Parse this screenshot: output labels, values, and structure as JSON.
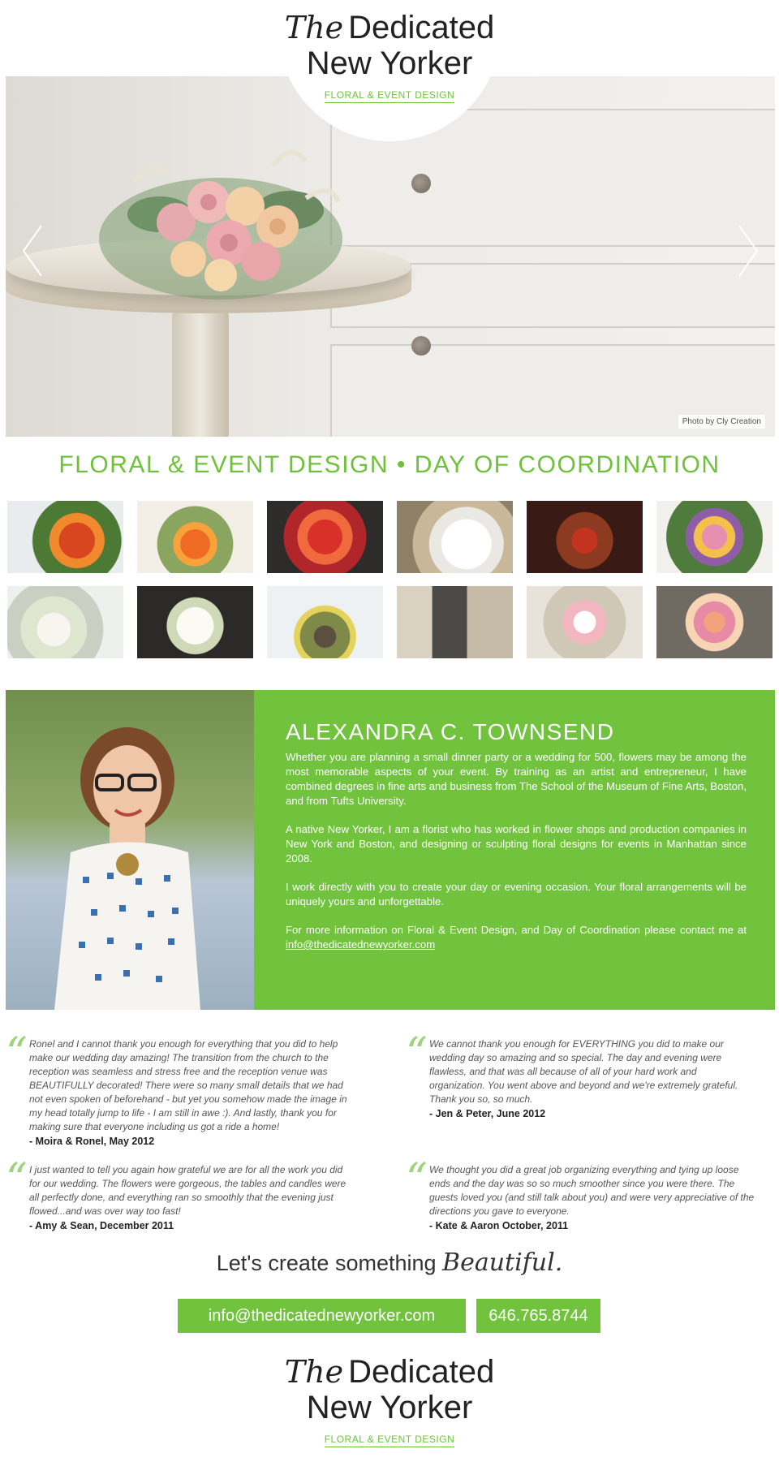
{
  "logo": {
    "the": "The",
    "dedicated": "Dedicated",
    "line2": "New Yorker",
    "subtitle": "FLORAL & EVENT DESIGN"
  },
  "hero": {
    "photo_credit": "Photo by Cly Creation",
    "prev_icon": "chevron-left-icon",
    "next_icon": "chevron-right-icon"
  },
  "tagline": "FLORAL & EVENT DESIGN • DAY OF COORDINATION",
  "gallery": {
    "thumb_count": 12
  },
  "about": {
    "name": "ALEXANDRA C. TOWNSEND",
    "p1": "Whether you are planning a small dinner party or a wedding for 500, flowers may be among the most memorable aspects of your event. By training as an artist and entrepreneur, I have combined degrees in fine arts and business from The School of the Museum of Fine Arts, Boston, and from Tufts University.",
    "p2": "A native New Yorker, I am a florist who has worked in flower shops and production companies in New York and Boston, and designing or sculpting floral designs for events in Manhattan since 2008.",
    "p3": "I work directly with you to create your day or evening occasion. Your floral arrangements will be uniquely yours and unforgettable.",
    "p4_text": "For more information on Floral & Event Design, and Day of Coordination please contact me at ",
    "p4_link": "info@thedicatednewyorker.com"
  },
  "testimonials": [
    {
      "text": "Ronel and I cannot thank you enough for everything that you did to help make our wedding day amazing! The transition from the church to the reception was seamless and stress free and the reception venue was BEAUTIFULLY decorated! There were so many small details that we had not even spoken of beforehand - but yet you somehow made the image in my head totally jump to life - I am still in awe :). And lastly, thank you for making sure that everyone including us got a ride a home!",
      "author": "- Moira & Ronel, May 2012"
    },
    {
      "text": "We cannot thank you enough for EVERYTHING you did to make our wedding day so amazing and so special. The day and evening were flawless, and that was all because of all of your hard work and organization. You went above and beyond and we're extremely grateful. Thank you so, so much.",
      "author": "- Jen & Peter, June 2012"
    },
    {
      "text": "I just wanted to tell you again how grateful we are for all the work you did for our wedding. The flowers were gorgeous, the tables and candles were all perfectly done, and everything ran so smoothly that the evening just flowed...and was over way too fast!",
      "author": "- Amy & Sean, December 2011"
    },
    {
      "text": "We thought you did a great job organizing everything and tying up loose ends and the day was so so much smoother since you were there. The guests loved you (and still talk about you) and were very appreciative of the directions you gave to everyone.",
      "author": "- Kate & Aaron October, 2011"
    }
  ],
  "cta": {
    "lead": "Let's create something",
    "script": "Beautiful.",
    "email": "info@thedicatednewyorker.com",
    "phone": "646.765.8744"
  },
  "colors": {
    "accent": "#71c33e",
    "accent_text": "#6ec23a"
  }
}
